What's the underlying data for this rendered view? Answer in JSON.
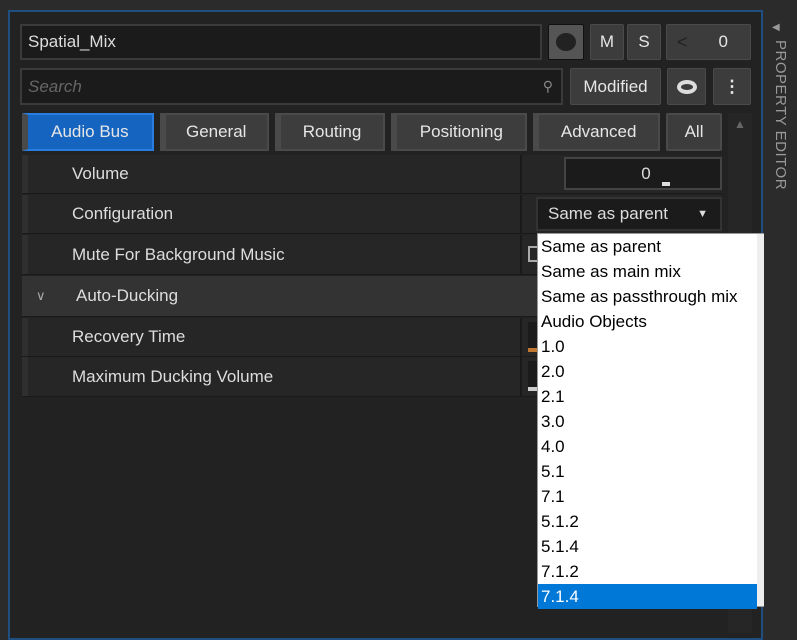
{
  "header": {
    "name": "Spatial_Mix",
    "mute_label": "M",
    "solo_label": "S",
    "references_count": "0"
  },
  "search": {
    "placeholder": "Search",
    "modified_label": "Modified"
  },
  "tabs": [
    {
      "label": "Audio Bus",
      "active": true
    },
    {
      "label": "General"
    },
    {
      "label": "Routing"
    },
    {
      "label": "Positioning"
    },
    {
      "label": "Advanced"
    },
    {
      "label": "All"
    }
  ],
  "properties": {
    "volume_label": "Volume",
    "volume_value": "0",
    "configuration_label": "Configuration",
    "configuration_value": "Same as parent",
    "mute_bg_label": "Mute For Background Music",
    "auto_ducking_label": "Auto-Ducking",
    "recovery_label": "Recovery Time",
    "max_ducking_label": "Maximum Ducking Volume"
  },
  "dropdown": {
    "options": [
      "Same as parent",
      "Same as main mix",
      "Same as passthrough mix",
      "Audio Objects",
      "1.0",
      "2.0",
      "2.1",
      "3.0",
      "4.0",
      "5.1",
      "7.1",
      "5.1.2",
      "5.1.4",
      "7.1.2",
      "7.1.4"
    ],
    "selected": "7.1.4"
  },
  "side_panel": {
    "title": "PROPERTY EDITOR"
  },
  "colors": {
    "accent": "#1565c0",
    "selection": "#0078d7",
    "panel_border": "#1f4f80"
  }
}
